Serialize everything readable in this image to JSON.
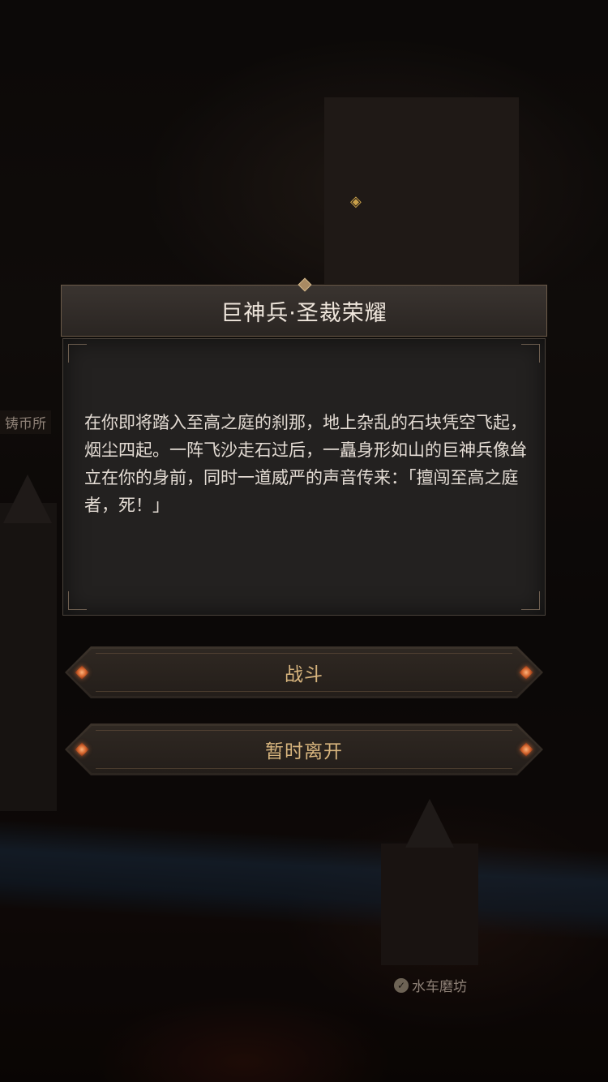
{
  "map": {
    "labels": {
      "mint": "铸币所",
      "watermill": "水车磨坊"
    }
  },
  "dialog": {
    "title": "巨神兵·圣裁荣耀",
    "text": "在你即将踏入至高之庭的刹那，地上杂乱的石块凭空飞起，烟尘四起。一阵飞沙走石过后，一矗身形如山的巨神兵像耸立在你的身前，同时一道威严的声音传来：「擅闯至高之庭者，死！」"
  },
  "actions": {
    "fight_label": "战斗",
    "leave_label": "暂时离开"
  },
  "colors": {
    "button_text": "#d8b57e",
    "gem": "#d0602a",
    "title_text": "#efe6dc"
  }
}
